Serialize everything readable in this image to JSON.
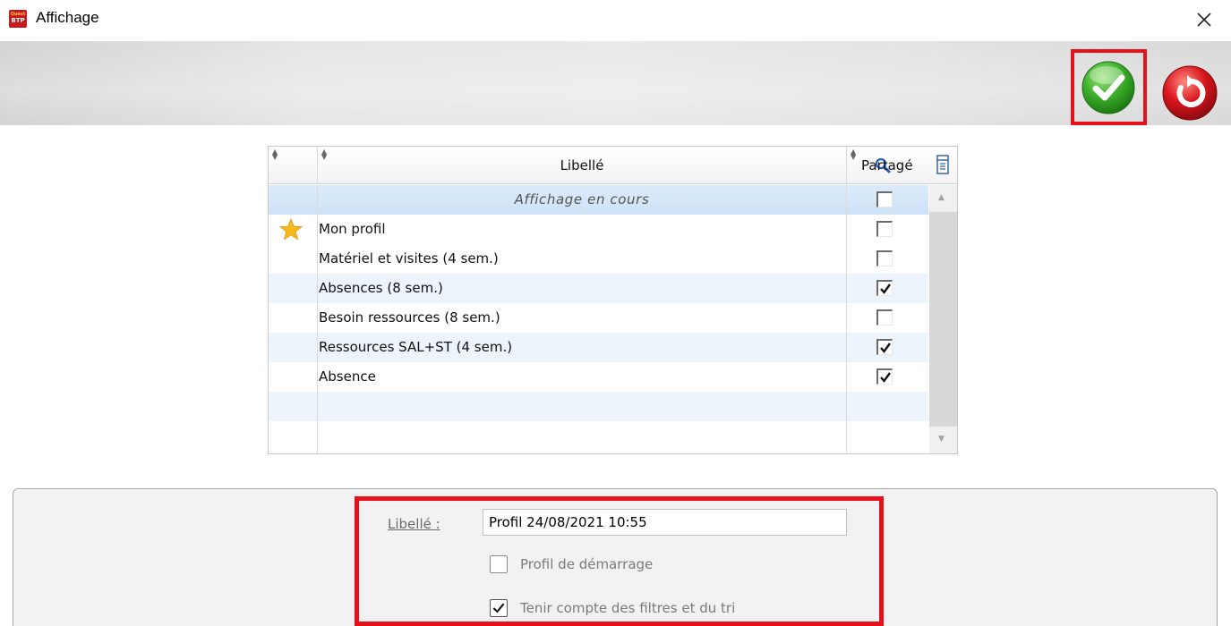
{
  "window": {
    "title": "Affichage",
    "logo_text_top": "Quest",
    "logo_text_bottom": "BTP"
  },
  "grid": {
    "columns": {
      "libelle": "Libellé",
      "partage": "Partagé"
    },
    "rows": [
      {
        "label": "Affichage en cours",
        "shared": false,
        "current": true,
        "favorite": false
      },
      {
        "label": "Mon profil",
        "shared": false,
        "current": false,
        "favorite": true
      },
      {
        "label": "Matériel et visites (4 sem.)",
        "shared": false,
        "current": false,
        "favorite": false
      },
      {
        "label": "Absences (8 sem.)",
        "shared": true,
        "current": false,
        "favorite": false
      },
      {
        "label": "Besoin ressources (8 sem.)",
        "shared": false,
        "current": false,
        "favorite": false
      },
      {
        "label": "Ressources SAL+ST (4 sem.)",
        "shared": true,
        "current": false,
        "favorite": false
      },
      {
        "label": "Absence",
        "shared": true,
        "current": false,
        "favorite": false
      }
    ]
  },
  "form": {
    "libelle_label": "Libellé :",
    "libelle_value": "Profil 24/08/2021 10:55",
    "startup_profile_label": "Profil de démarrage",
    "startup_profile_checked": false,
    "filters_label": "Tenir compte des filtres et du tri",
    "filters_checked": true
  },
  "colors": {
    "highlight_border": "#e8101a",
    "ok_green": "#3cae2a",
    "cancel_red": "#d8141c",
    "selected_row": "#d6e7f8",
    "alt_row": "#eef4fb"
  },
  "icons": {
    "close": "close-icon",
    "ok": "check-circle-icon",
    "cancel": "undo-circle-icon",
    "search": "magnifier-icon",
    "columns": "columns-icon",
    "favorite": "star-icon"
  }
}
